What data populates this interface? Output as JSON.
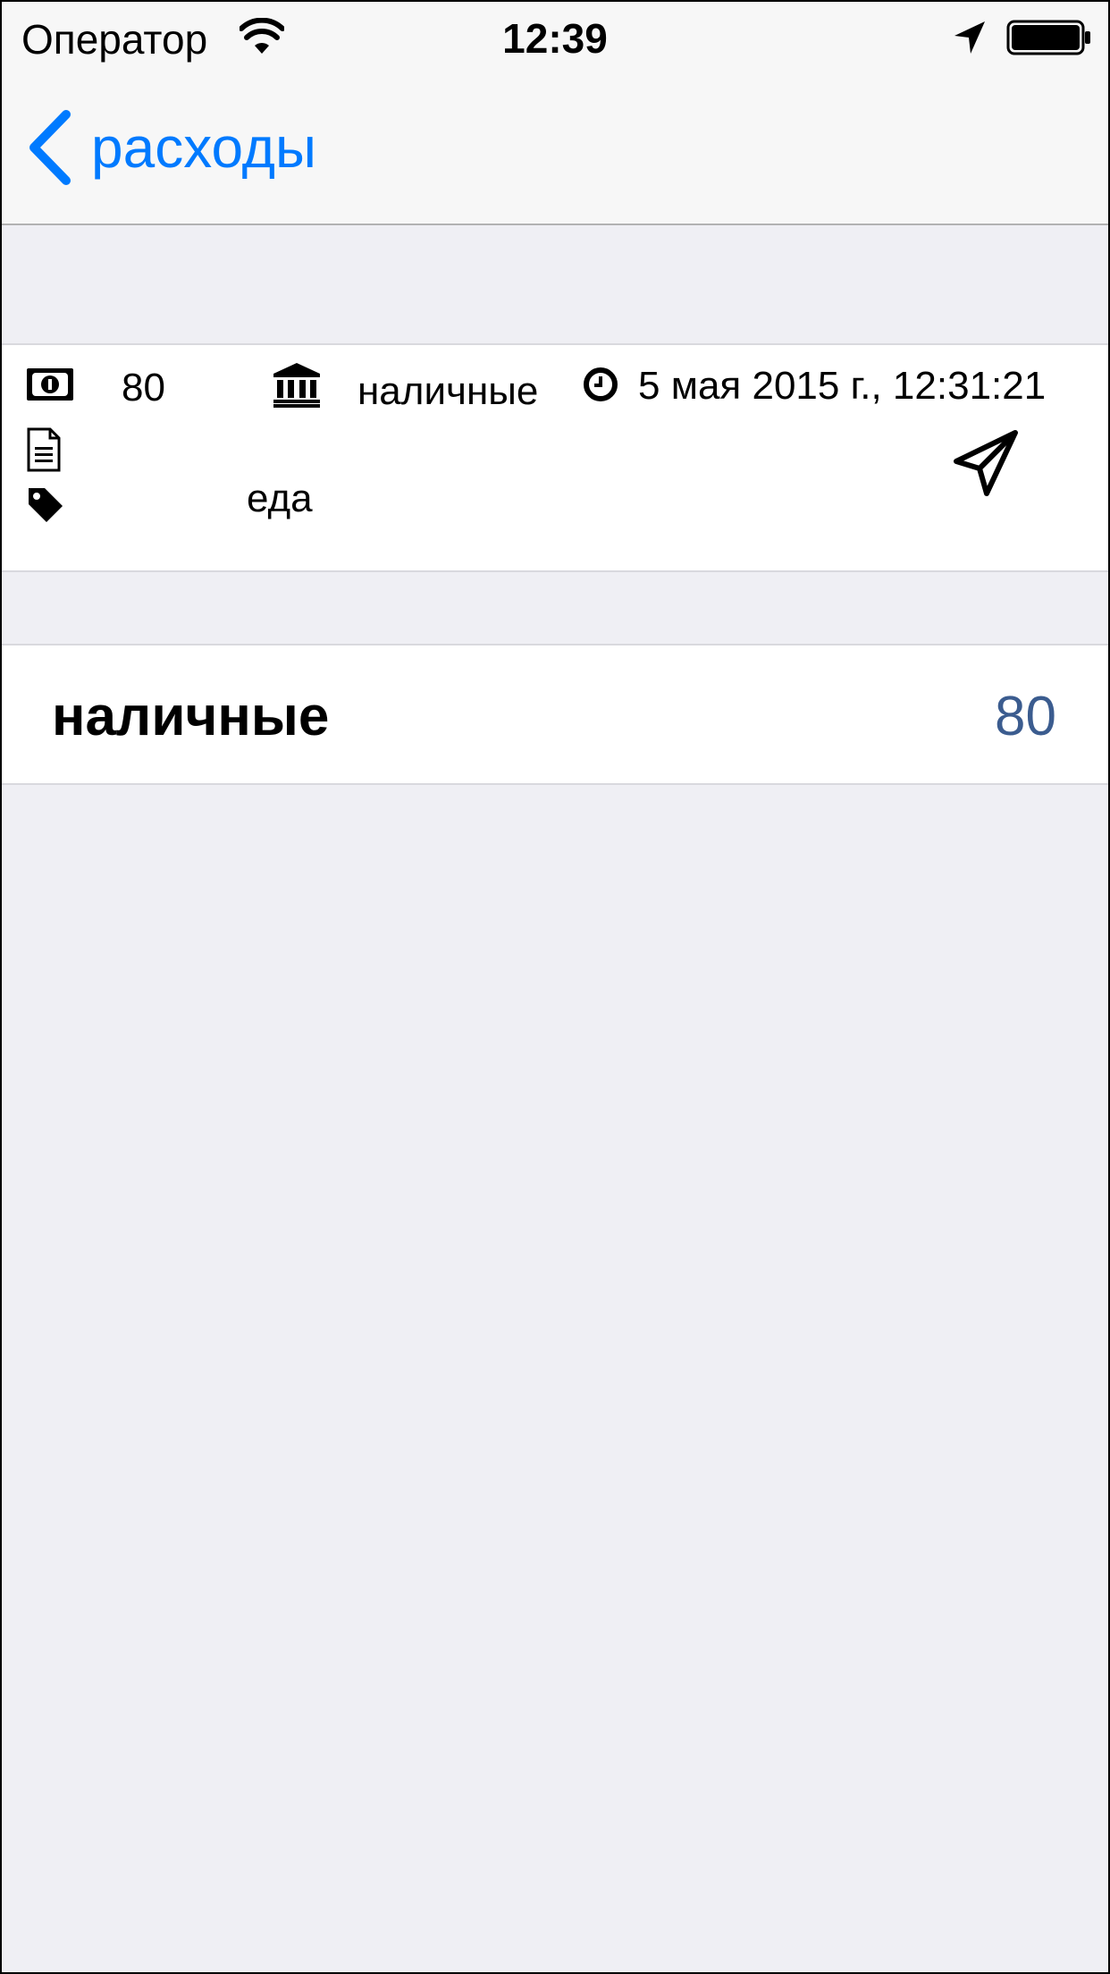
{
  "status_bar": {
    "carrier": "Оператор",
    "time": "12:39"
  },
  "nav": {
    "back_label": "расходы",
    "accent_color": "#007aff"
  },
  "transaction": {
    "amount": "80",
    "account": "наличные",
    "datetime": "5 мая 2015 г., 12:31:21",
    "note": "",
    "category": "еда",
    "icons": [
      "money-icon",
      "bank-icon",
      "clock-icon",
      "document-icon",
      "tag-icon",
      "send-icon"
    ]
  },
  "summary": {
    "account_name": "наличные",
    "total": "80",
    "value_color": "#3b5c8f"
  }
}
